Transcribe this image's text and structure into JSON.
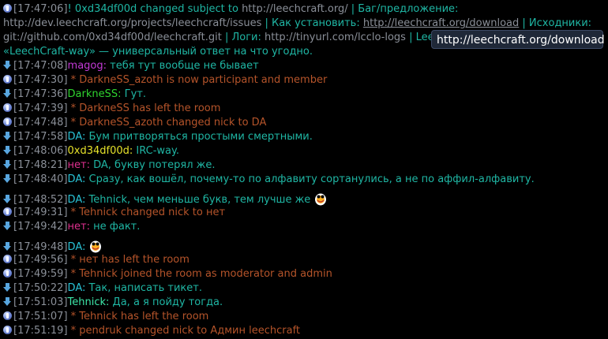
{
  "topic": {
    "timestamp": "[17:47:06]",
    "prefix": "! 0xd34df00d changed subject to ",
    "url1": "http://leechcraft.org/",
    "sep1": " | Баг/предложение: ",
    "url2": "http://dev.leechcraft.org/projects/leechcraft/issues",
    "sep2": " | Как установить: ",
    "url3": "http://leechcraft.org/download",
    "sep3": " | Исходники: ",
    "url4": "git://github.com/0xd34df00d/leechcraft.git",
    "sep4": " | Логи: ",
    "url5": "http://tinyurl.com/lcclo-logs",
    "sep5": " | LeechC",
    "last": "«LeechCraft-way» — универсальный ответ на что угодно."
  },
  "tooltip": "http://leechcraft.org/download",
  "lines": [
    {
      "icon": "down-arrow-icon",
      "ts": "[17:47:08]",
      "nick": "magog:",
      "nick_color": "#c33ad6",
      "text": " тебя тут вообще не бывает",
      "kind": "msg"
    },
    {
      "icon": "info-icon",
      "ts": "[17:47:30]",
      "text": " * DarkneSS_azoth is now participant and member",
      "kind": "sys"
    },
    {
      "icon": "down-arrow-icon",
      "ts": "[17:47:36]",
      "nick": "DarkneSS:",
      "nick_color": "#2fd42f",
      "text": " Гут.",
      "kind": "msg"
    },
    {
      "icon": "info-icon",
      "ts": "[17:47:39]",
      "text": " * DarkneSS has left the room",
      "kind": "sys"
    },
    {
      "icon": "info-icon",
      "ts": "[17:47:48]",
      "text": " * DarkneSS_azoth changed nick to DA",
      "kind": "sys"
    },
    {
      "icon": "down-arrow-icon",
      "ts": "[17:47:58]",
      "nick": "DA:",
      "nick_color": "#29c3d6",
      "text": " Бум притворяться простыми смертными.",
      "kind": "msg"
    },
    {
      "icon": "down-arrow-icon",
      "ts": "[17:48:06]",
      "nick": "0xd34df00d:",
      "nick_color": "#e6e22a",
      "text": " IRC-way.",
      "kind": "msg"
    },
    {
      "icon": "down-arrow-icon",
      "ts": "[17:48:21]",
      "nick": "нет:",
      "nick_color": "#e0308f",
      "text": " DA, букву потерял же.",
      "kind": "msg"
    },
    {
      "icon": "down-arrow-icon",
      "ts": "[17:48:40]",
      "nick": "DA:",
      "nick_color": "#29c3d6",
      "text": " Сразу, как вошёл, почему-то по алфавиту сортанулись, а не по аффил-алфавиту.",
      "kind": "msg"
    },
    {
      "icon": "down-arrow-icon",
      "ts": "[17:48:52]",
      "nick": "DA:",
      "nick_color": "#29c3d6",
      "text": " Tehnick, чем меньше букв, тем лучше же",
      "kind": "msg",
      "smiley": true
    },
    {
      "icon": "info-icon",
      "ts": "[17:49:31]",
      "text": " * Tehnick changed nick to нет",
      "kind": "sys"
    },
    {
      "icon": "down-arrow-icon",
      "ts": "[17:49:42]",
      "nick": "нет:",
      "nick_color": "#e0308f",
      "text": " не факт.",
      "kind": "msg"
    },
    {
      "icon": "down-arrow-icon",
      "ts": "[17:49:48]",
      "nick": "DA:",
      "nick_color": "#29c3d6",
      "text": "",
      "kind": "msg",
      "smiley": true
    },
    {
      "icon": "info-icon",
      "ts": "[17:49:56]",
      "text": " * нет has left the room",
      "kind": "sys"
    },
    {
      "icon": "info-icon",
      "ts": "[17:49:59]",
      "text": " * Tehnick joined the room as moderator and admin",
      "kind": "sys"
    },
    {
      "icon": "down-arrow-icon",
      "ts": "[17:50:22]",
      "nick": "DA:",
      "nick_color": "#29c3d6",
      "text": " Так, написать тикет.",
      "kind": "msg"
    },
    {
      "icon": "down-arrow-icon",
      "ts": "[17:51:03]",
      "nick": "Tehnick:",
      "nick_color": "#3de6a8",
      "text": " Да, а я пойду тогда.",
      "kind": "msg"
    },
    {
      "icon": "info-icon",
      "ts": "[17:51:07]",
      "text": " * Tehnick has left the room",
      "kind": "sys"
    },
    {
      "icon": "info-icon",
      "ts": "[17:51:19]",
      "text": " * pendruk changed nick to Админ leechcraft",
      "kind": "sys"
    }
  ]
}
